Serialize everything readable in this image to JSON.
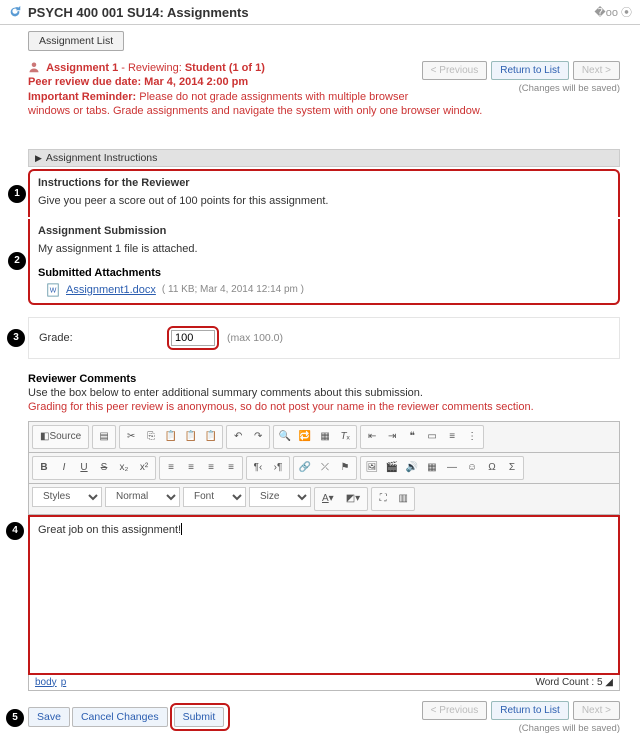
{
  "header": {
    "title": "PSYCH 400 001 SU14: Assignments"
  },
  "tab": {
    "label": "Assignment List"
  },
  "nav": {
    "prev": "< Previous",
    "return": "Return to List",
    "next": "Next >",
    "note": "(Changes will be saved)"
  },
  "assignment": {
    "title_prefix": "Assignment 1",
    "title_mid": " - Reviewing: ",
    "title_suffix": "Student (1 of 1)",
    "due_label": "Peer review due date: ",
    "due_value": "Mar 4, 2014 2:00 pm",
    "reminder_label": "Important Reminder: ",
    "reminder_text": "Please do not grade assignments with multiple browser windows or tabs. Grade assignments and navigate the system with only one browser window."
  },
  "instructions_bar": "Assignment Instructions",
  "reviewer_box": {
    "head": "Instructions for the Reviewer",
    "text": "Give you peer a score out of 100 points for this assignment."
  },
  "submission_box": {
    "head": "Assignment Submission",
    "text": "My assignment 1 file is attached.",
    "attach_head": "Submitted Attachments",
    "file_name": "Assignment1.docx",
    "file_meta": "( 11 KB; Mar 4, 2014 12:14 pm )"
  },
  "badges": {
    "b1": "1",
    "b2": "2",
    "b3": "3",
    "b4": "4",
    "b5": "5"
  },
  "grade": {
    "label": "Grade:",
    "value": "100",
    "max": "(max 100.0)"
  },
  "reviewer_comments": {
    "head": "Reviewer Comments",
    "help": "Use the box below to enter additional summary comments about this submission.",
    "warn": "Grading for this peer review is anonymous, so do not post your name in the reviewer comments section."
  },
  "editor": {
    "source": "Source",
    "styles": "Styles",
    "format": "Normal",
    "font": "Font",
    "size": "Size",
    "content": "Great job on this assignment!",
    "path_body": "body",
    "path_p": "p",
    "wc_label": "Word Count : ",
    "wc_value": "5"
  },
  "actions": {
    "save": "Save",
    "cancel": "Cancel Changes",
    "submit": "Submit"
  }
}
